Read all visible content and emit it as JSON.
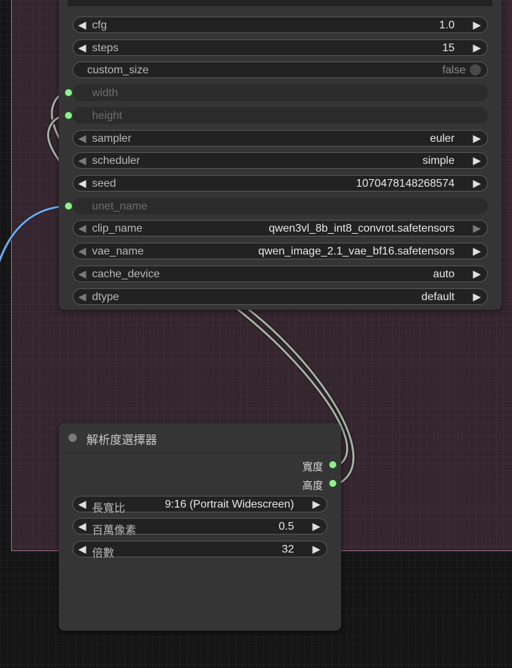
{
  "main_node": {
    "widgets": [
      {
        "label": "cfg",
        "value": "1.0"
      },
      {
        "label": "steps",
        "value": "15"
      },
      {
        "label": "custom_size",
        "value": "false"
      },
      {
        "label": "width"
      },
      {
        "label": "height"
      },
      {
        "label": "sampler",
        "value": "euler"
      },
      {
        "label": "scheduler",
        "value": "simple"
      },
      {
        "label": "seed",
        "value": "1070478148268574"
      },
      {
        "label": "unet_name"
      },
      {
        "label": "clip_name",
        "value": "qwen3vl_8b_int8_convrot.safetensors"
      },
      {
        "label": "vae_name",
        "value": "qwen_image_2.1_vae_bf16.safetensors"
      },
      {
        "label": "cache_device",
        "value": "auto"
      },
      {
        "label": "dtype",
        "value": "default"
      }
    ]
  },
  "resolution_node": {
    "title": "解析度選擇器",
    "outputs": [
      "寬度",
      "高度"
    ],
    "widgets": [
      {
        "label": "長寬比",
        "value": "9:16 (Portrait Widescreen)"
      },
      {
        "label": "百萬像素",
        "value": "0.5"
      },
      {
        "label": "倍數",
        "value": "32"
      }
    ]
  },
  "icons": {
    "decrement": "triangle-left-icon",
    "increment": "triangle-right-icon",
    "slot": "input-slot-dot-icon"
  },
  "colors": {
    "group_bg": "#35252f",
    "group_border": "#a26b8d",
    "node_bg": "#353535",
    "slot_green": "#8ef08e",
    "link_gray": "#a8aea6",
    "link_blue": "#6fa8f0"
  }
}
